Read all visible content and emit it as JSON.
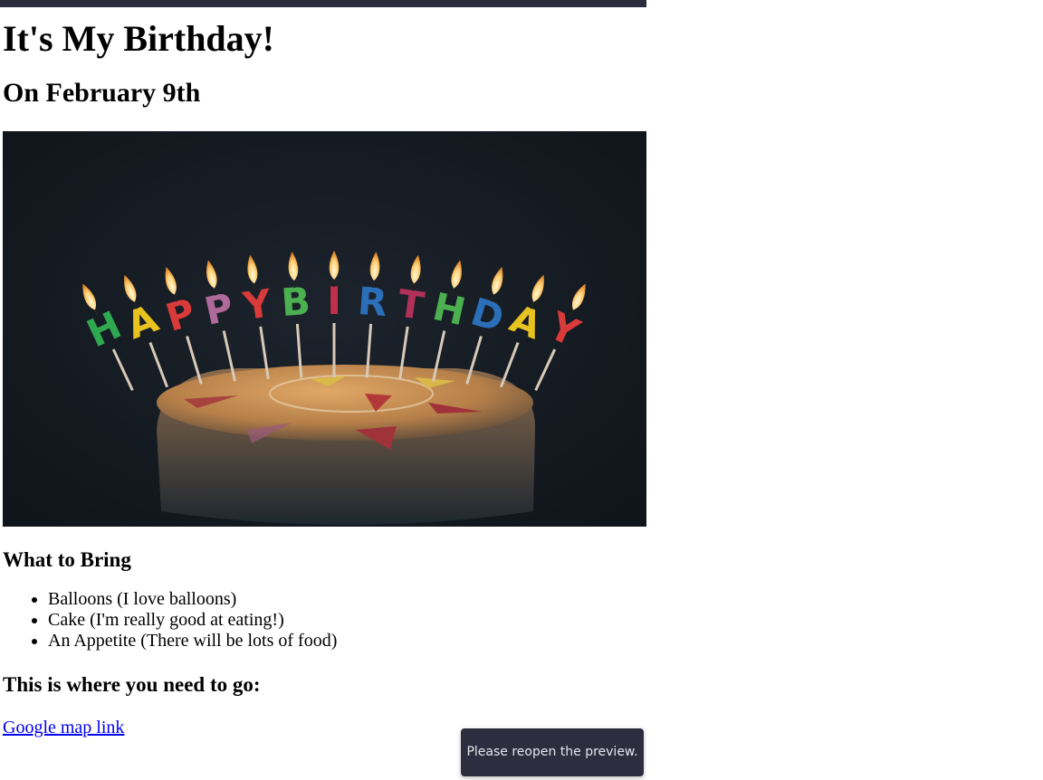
{
  "page": {
    "title": "It's My Birthday!",
    "subtitle": "On February 9th",
    "hero_image": {
      "alt": "Happy Birthday cake",
      "candle_letters": [
        "H",
        "A",
        "P",
        "P",
        "Y",
        "B",
        "I",
        "R",
        "T",
        "H",
        "D",
        "A",
        "Y"
      ],
      "candle_colors": [
        "#2fa84f",
        "#e8c21f",
        "#d93a3a",
        "#b06a9a",
        "#d93a3a",
        "#4caf50",
        "#c0304a",
        "#2a6fb8",
        "#b0305a",
        "#4caf50",
        "#2a6fb8",
        "#e8c21f",
        "#d93a3a"
      ]
    },
    "bring_heading": "What to Bring",
    "bring_items": [
      "Balloons (I love balloons)",
      "Cake (I'm really good at eating!)",
      "An Appetite (There will be lots of food)"
    ],
    "where_heading": "This is where you need to go:",
    "map_link_label": "Google map link"
  },
  "toast": {
    "message": "Please reopen the preview."
  },
  "colors": {
    "top_bar": "#2b2b3d",
    "link": "#0000ee",
    "toast_bg": "#2d2d3f"
  }
}
